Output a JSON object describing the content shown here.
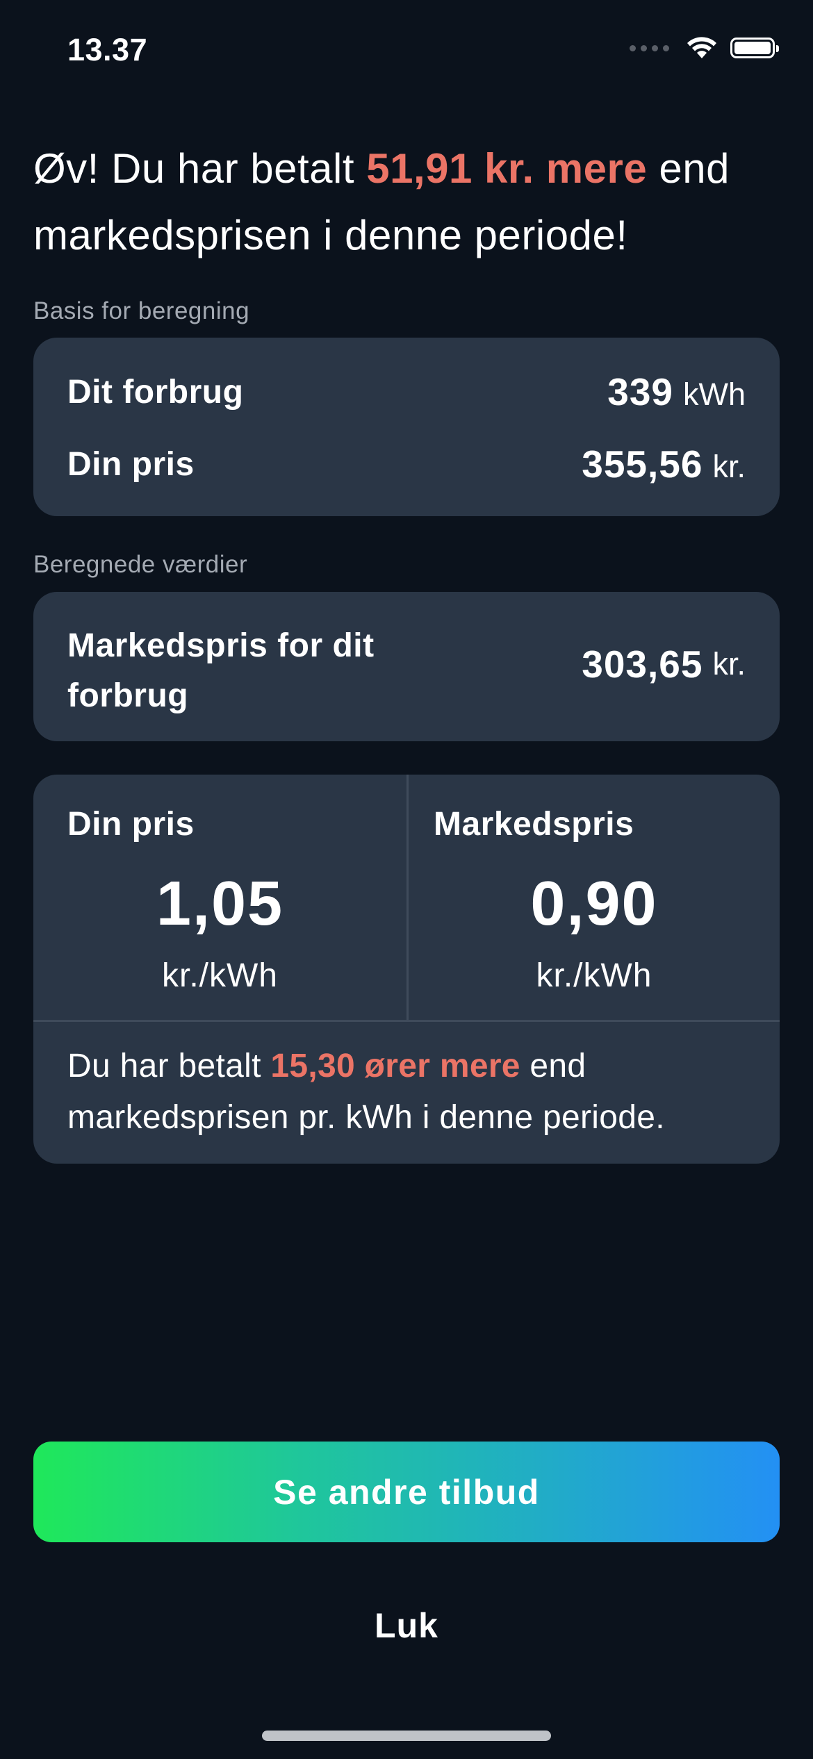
{
  "status_bar": {
    "time": "13.37",
    "icons": [
      "cellular-signal-icon",
      "wifi-icon",
      "battery-icon"
    ]
  },
  "headline": {
    "part1": "Øv! Du har betalt ",
    "highlight": "51,91 kr. mere",
    "part2": " end markedsprisen i denne periode!"
  },
  "basis_section": {
    "label": "Basis for beregning",
    "rows": [
      {
        "label": "Dit forbrug",
        "value": "339",
        "unit": "kWh"
      },
      {
        "label": "Din pris",
        "value": "355,56",
        "unit": "kr."
      }
    ]
  },
  "calculated_section": {
    "label": "Beregnede værdier",
    "market_label": "Markedspris for dit forbrug",
    "market_value": "303,65",
    "market_unit": "kr."
  },
  "comparison": {
    "left": {
      "title": "Din pris",
      "value": "1,05",
      "unit": "kr./kWh"
    },
    "right": {
      "title": "Markedspris",
      "value": "0,90",
      "unit": "kr./kWh"
    },
    "note_part1": "Du har betalt ",
    "note_highlight": "15,30 ører mere",
    "note_part2": " end markedsprisen pr. kWh i denne periode."
  },
  "actions": {
    "primary_label": "Se andre tilbud",
    "close_label": "Luk"
  },
  "colors": {
    "background": "#0b121c",
    "card": "#2a3646",
    "accent_red": "#eb7466",
    "gradient_start": "#1fe85a",
    "gradient_end": "#2390f4"
  }
}
